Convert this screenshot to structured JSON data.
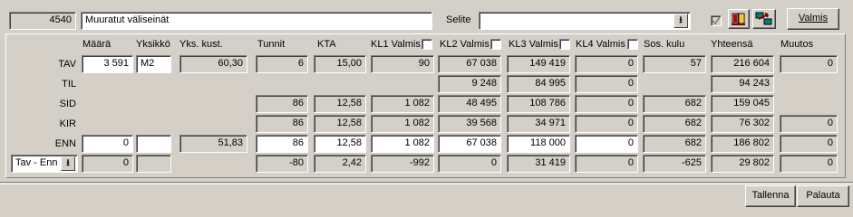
{
  "header": {
    "code": "4540",
    "name": "Muuratut väliseinät",
    "selite_label": "Selite",
    "selite_value": "",
    "valmis_button": "Valmis",
    "checkbox_checked": true
  },
  "columns": {
    "maara": "Määrä",
    "yksikko": "Yksikkö",
    "yks_kust": "Yks. kust.",
    "tunnit": "Tunnit",
    "kta": "KTA",
    "kl1": "KL1 Valmis",
    "kl2": "KL2 Valmis",
    "kl3": "KL3 Valmis",
    "kl4": "KL4  Valmis",
    "sos_kulu": "Sos. kulu",
    "yhteensa": "Yhteensä",
    "muutos": "Muutos"
  },
  "rows": {
    "tav": {
      "label": "TAV",
      "maara": "3 591",
      "yksikko": "M2",
      "yks_kust": "60,30",
      "tunnit": "6",
      "kta": "15,00",
      "kl1": "90",
      "kl2": "67 038",
      "kl3": "149 419",
      "kl4": "0",
      "sos": "57",
      "yht": "216 604",
      "muutos": "0"
    },
    "til": {
      "label": "TIL",
      "kl2": "9 248",
      "kl3": "84 995",
      "kl4": "0",
      "yht": "94 243"
    },
    "sid": {
      "label": "SID",
      "tunnit": "86",
      "kta": "12,58",
      "kl1": "1 082",
      "kl2": "48 495",
      "kl3": "108 786",
      "kl4": "0",
      "sos": "682",
      "yht": "159 045"
    },
    "kir": {
      "label": "KIR",
      "tunnit": "86",
      "kta": "12,58",
      "kl1": "1 082",
      "kl2": "39 568",
      "kl3": "34 971",
      "kl4": "0",
      "sos": "682",
      "yht": "76 302",
      "muutos": "0"
    },
    "enn": {
      "label": "ENN",
      "maara": "0",
      "yksikko": "",
      "yks_kust": "51,83",
      "tunnit": "86",
      "kta": "12,58",
      "kl1": "1 082",
      "kl2": "67 038",
      "kl3": "118 000",
      "kl4": "0",
      "sos": "682",
      "yht": "186 802",
      "muutos": "0"
    },
    "diff": {
      "selector": "Tav - Enn",
      "maara": "0",
      "yksikko": "",
      "tunnit": "-80",
      "kta": "2,42",
      "kl1": "-992",
      "kl2": "0",
      "kl3": "31 419",
      "kl4": "0",
      "sos": "-625",
      "yht": "29 802",
      "muutos": "0"
    }
  },
  "footer": {
    "tallenna": "Tallenna",
    "palauta": "Palauta"
  }
}
